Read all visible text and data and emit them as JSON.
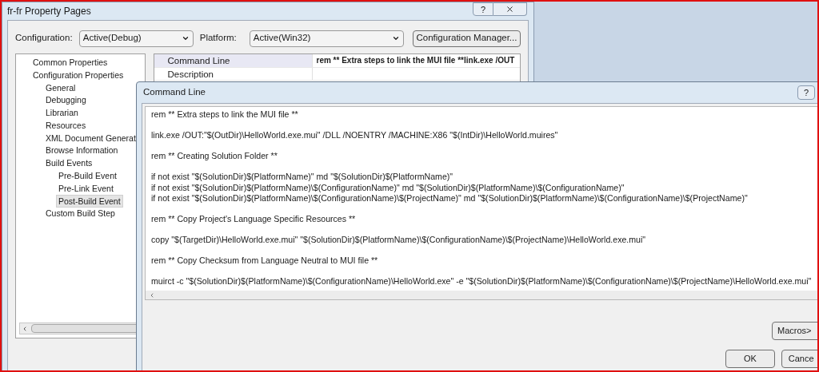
{
  "property_window": {
    "title": "fr-fr Property Pages",
    "help_button": "?",
    "configuration": {
      "label": "Configuration:",
      "value": "Active(Debug)"
    },
    "platform": {
      "label": "Platform:",
      "value": "Active(Win32)"
    },
    "configuration_manager_button": "Configuration Manager...",
    "tree": [
      {
        "label": "Common Properties",
        "selected": false
      },
      {
        "label": "Configuration Properties",
        "selected": false,
        "children": [
          {
            "label": "General",
            "selected": false
          },
          {
            "label": "Debugging",
            "selected": false
          },
          {
            "label": "Librarian",
            "selected": false
          },
          {
            "label": "Resources",
            "selected": false
          },
          {
            "label": "XML Document Generat",
            "selected": false
          },
          {
            "label": "Browse Information",
            "selected": false
          },
          {
            "label": "Build Events",
            "selected": false,
            "children": [
              {
                "label": "Pre-Build Event",
                "selected": false
              },
              {
                "label": "Pre-Link Event",
                "selected": false
              },
              {
                "label": "Post-Build Event",
                "selected": true
              }
            ]
          },
          {
            "label": "Custom Build Step",
            "selected": false
          }
        ]
      }
    ],
    "properties": [
      {
        "name": "Command Line",
        "value": "rem ** Extra steps to link the MUI file **link.exe /OUT",
        "selected": true
      },
      {
        "name": "Description",
        "selected": false
      }
    ]
  },
  "command_dialog": {
    "title": "Command Line",
    "help_button": "?",
    "paragraphs": [
      [
        "rem ** Extra steps to link the MUI file **"
      ],
      [
        "link.exe /OUT:\"$(OutDir)\\HelloWorld.exe.mui\" /DLL /NOENTRY /MACHINE:X86  \"$(IntDir)\\HelloWorld.muires\""
      ],
      [
        "rem ** Creating Solution Folder **"
      ],
      [
        "if not exist \"$(SolutionDir)$(PlatformName)\" md \"$(SolutionDir)$(PlatformName)\"",
        "if not exist \"$(SolutionDir)$(PlatformName)\\$(ConfigurationName)\" md \"$(SolutionDir)$(PlatformName)\\$(ConfigurationName)\"",
        "if not exist \"$(SolutionDir)$(PlatformName)\\$(ConfigurationName)\\$(ProjectName)\" md \"$(SolutionDir)$(PlatformName)\\$(ConfigurationName)\\$(ProjectName)\""
      ],
      [
        "rem ** Copy Project's Language Specific Resources **"
      ],
      [
        "copy \"$(TargetDir)\\HelloWorld.exe.mui\" \"$(SolutionDir)$(PlatformName)\\$(ConfigurationName)\\$(ProjectName)\\HelloWorld.exe.mui\""
      ],
      [
        "rem ** Copy Checksum from Language Neutral to MUI file **"
      ],
      [
        "muirct -c \"$(SolutionDir)$(PlatformName)\\$(ConfigurationName)\\HelloWorld.exe\" -e \"$(SolutionDir)$(PlatformName)\\$(ConfigurationName)\\$(ProjectName)\\HelloWorld.exe.mui\""
      ]
    ],
    "macros_button": "Macros>",
    "ok_button": "OK",
    "cancel_button": "Cance"
  }
}
